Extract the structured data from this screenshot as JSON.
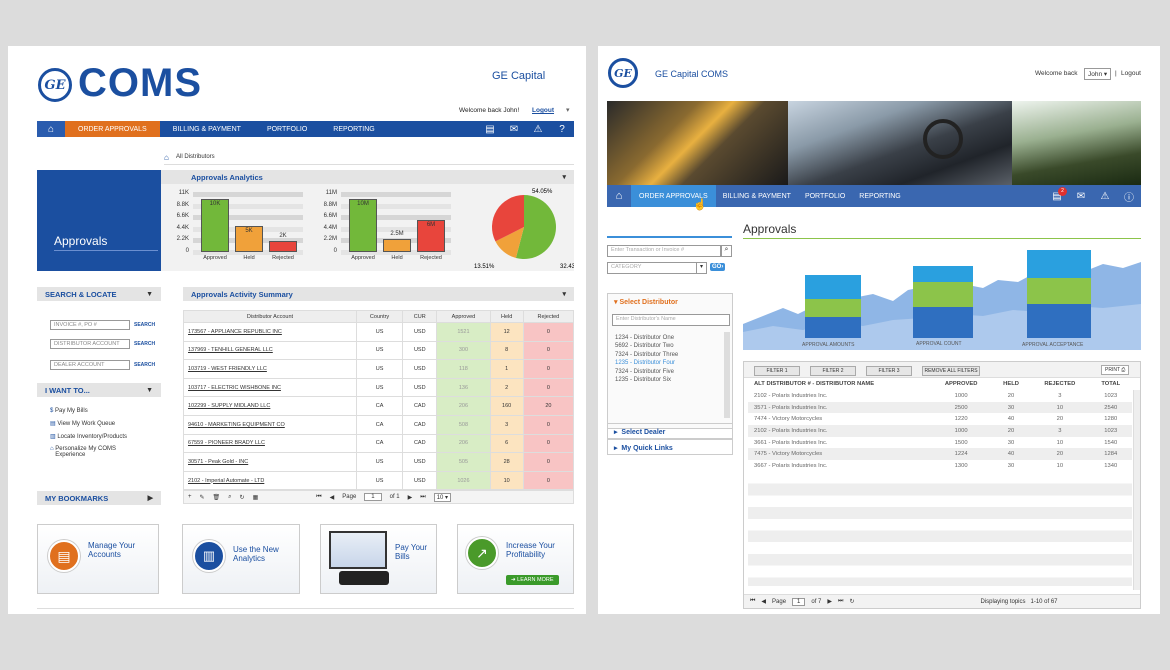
{
  "left": {
    "logo_text": "COMS",
    "brand": "GE Capital",
    "welcome": "Welcome back John!",
    "logout": "Logout",
    "nav": [
      "ORDER APPROVALS",
      "BILLING & PAYMENT",
      "PORTFOLIO",
      "REPORTING"
    ],
    "breadcrumb": "All Distributors",
    "hero_title": "Approvals",
    "analytics_title": "Approvals Analytics",
    "chart1": {
      "ticks": [
        "11K",
        "8.8K",
        "6.6K",
        "4.4K",
        "2.2K",
        "0"
      ],
      "bars": [
        {
          "label": "10K",
          "value": 10,
          "color": "#72b83a"
        },
        {
          "label": "5K",
          "value": 5,
          "color": "#f0a13a"
        },
        {
          "label": "2K",
          "value": 2,
          "color": "#e8453c"
        }
      ],
      "categories": [
        "Approved",
        "Held",
        "Rejected"
      ],
      "max": 11
    },
    "chart2": {
      "ticks": [
        "11M",
        "8.8M",
        "6.6M",
        "4.4M",
        "2.2M",
        "0"
      ],
      "bars": [
        {
          "label": "10M",
          "value": 10,
          "color": "#72b83a"
        },
        {
          "label": "2.5M",
          "value": 2.5,
          "color": "#f0a13a"
        },
        {
          "label": "6M",
          "value": 6,
          "color": "#e8453c"
        }
      ],
      "categories": [
        "Approved",
        "Held",
        "Rejected"
      ],
      "max": 11
    },
    "pie": {
      "labels": [
        "54.05%",
        "13.51%",
        "32.43%"
      ],
      "values": [
        54.05,
        13.51,
        32.43
      ],
      "colors": [
        "#72b83a",
        "#f0a13a",
        "#e8453c"
      ]
    },
    "search_title": "SEARCH & LOCATE",
    "search_fields": [
      {
        "placeholder": "INVOICE #, PO #",
        "btn": "SEARCH"
      },
      {
        "placeholder": "DISTRIBUTOR ACCOUNT",
        "btn": "SEARCH"
      },
      {
        "placeholder": "DEALER ACCOUNT",
        "btn": "SEARCH"
      }
    ],
    "iwant_title": "I WANT TO...",
    "iwant": [
      "Pay My Bills",
      "View My Work Queue",
      "Locate Inventory/Products",
      "Personalize My COMS Experience"
    ],
    "bookmarks": "MY BOOKMARKS",
    "activity_title": "Approvals Activity Summary",
    "table_headers": [
      "Distributor Account",
      "Country",
      "CUR",
      "Approved",
      "Held",
      "Rejected"
    ],
    "rows": [
      [
        "173567 - APPLIANCE REPUBLIC INC",
        "US",
        "USD",
        "1521",
        "12",
        "0"
      ],
      [
        "137969 - TENHILL GENERAL LLC",
        "US",
        "USD",
        "300",
        "8",
        "0"
      ],
      [
        "103719 - WEST FRIENDLY LLC",
        "US",
        "USD",
        "118",
        "1",
        "0"
      ],
      [
        "103717 - ELECTRIC WISHBONE INC",
        "US",
        "USD",
        "136",
        "2",
        "0"
      ],
      [
        "102299 - SUPPLY MIDLAND LLC",
        "CA",
        "CAD",
        "206",
        "160",
        "20"
      ],
      [
        "94610 - MARKETING EQUIPMENT CO",
        "CA",
        "CAD",
        "508",
        "3",
        "0"
      ],
      [
        "67559 - PIONEER BRADY LLC",
        "CA",
        "CAD",
        "206",
        "6",
        "0"
      ],
      [
        "30571 - Peak Gold - INC",
        "US",
        "USD",
        "505",
        "28",
        "0"
      ],
      [
        "2102 - Imperial Automate - LTD",
        "US",
        "USD",
        "1026",
        "10",
        "0"
      ]
    ],
    "pager": {
      "page_label": "Page",
      "page": "1",
      "of": "of 1",
      "size": "10"
    },
    "tiles": [
      "Manage Your Accounts",
      "Use the New Analytics",
      "Pay Your Bills",
      "Increase Your Profitability"
    ],
    "learn_more": "LEARN MORE"
  },
  "right": {
    "brand": "GE Capital COMS",
    "welcome": "Welcome back",
    "user": "John",
    "logout": "Logout",
    "nav": [
      "ORDER APPROVALS",
      "BILLING & PAYMENT",
      "PORTFOLIO",
      "REPORTING"
    ],
    "badge": "2",
    "search_placeholder": "Enter Transaction or Invoice #",
    "category": "CATEGORY",
    "go": "GO",
    "select_distributor": "Select Distributor",
    "dist_placeholder": "Enter Distributor's Name",
    "distributors": [
      "1234 - Distributor One",
      "5692 - Distributor Two",
      "7324 - Distributor Three",
      "1235 - Distributor Four",
      "7324 - Distributor Five",
      "1235 - Distributor Six"
    ],
    "select_dealer": "Select Dealer",
    "quick_links": "My Quick Links",
    "approvals_title": "Approvals",
    "chart_labels": [
      "APPROVAL AMOUNTS",
      "APPROVAL COUNT",
      "APPROVAL ACCEPTANCE"
    ],
    "filters": [
      "FILTER 1",
      "FILTER 2",
      "FILTER 3",
      "REMOVE ALL FILTERS"
    ],
    "print": "PRINT",
    "headers": [
      "ALT DISTRIBUTOR # - DISTRIBUTOR NAME",
      "APPROVED",
      "HELD",
      "REJECTED",
      "TOTAL"
    ],
    "rows": [
      [
        "2102 - Polaris Industries Inc.",
        "1000",
        "20",
        "3",
        "1023"
      ],
      [
        "3571 - Polaris Industries Inc.",
        "2500",
        "30",
        "10",
        "2540"
      ],
      [
        "7474 - Victory Motorcycles",
        "1220",
        "40",
        "20",
        "1280"
      ],
      [
        "2102 - Polaris Industries Inc.",
        "1000",
        "20",
        "3",
        "1023"
      ],
      [
        "3661 - Polaris Industries Inc.",
        "1500",
        "30",
        "10",
        "1540"
      ],
      [
        "7475 - Victory Motorcycles",
        "1224",
        "40",
        "20",
        "1284"
      ],
      [
        "3667 - Polaris Industries Inc.",
        "1300",
        "30",
        "10",
        "1340"
      ]
    ],
    "pager": {
      "page_label": "Page",
      "page": "1",
      "of": "of 7",
      "status": "Displaying topics   1-10 of 67"
    }
  }
}
